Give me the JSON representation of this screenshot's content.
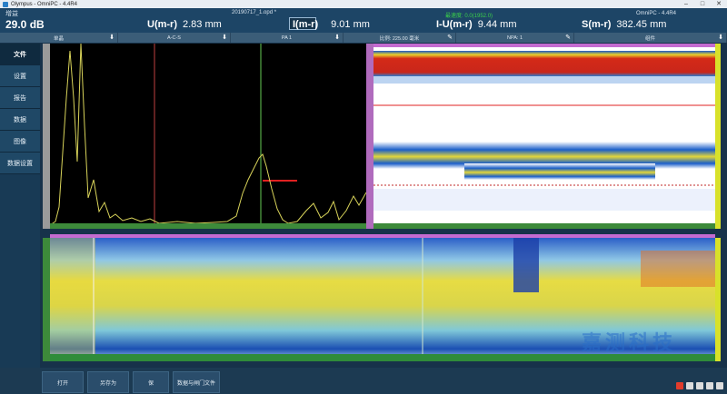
{
  "window": {
    "title": "Olympus - OmniPC - 4.4R4"
  },
  "readout": {
    "gain_label": "增益",
    "gain_value": "29.0 dB",
    "file_name": "20190717_1.opd *",
    "status_text": "最速度: 0.0(1952.0)",
    "right_title": "OmniPC - 4.4R4",
    "u_label": "U(m-r)",
    "u_value": "2.83 mm",
    "i_label": "I(m-r)",
    "i_value": "9.01 mm",
    "iu_label": "I-U(m-r)",
    "iu_value": "9.44 mm",
    "s_label": "S(m-r)",
    "s_value": "382.45 mm"
  },
  "params": [
    {
      "label": "单晶"
    },
    {
      "label": "A-C-S"
    },
    {
      "label": "PA 1"
    },
    {
      "label": "比例: 225.00 毫米"
    },
    {
      "label": "NPA: 1"
    },
    {
      "label": "组件"
    }
  ],
  "nav": [
    {
      "label": "文件",
      "active": true
    },
    {
      "label": "设置"
    },
    {
      "label": "报告"
    },
    {
      "label": "数据"
    },
    {
      "label": "图像"
    },
    {
      "label": "数据设置"
    }
  ],
  "bottom_buttons": [
    {
      "label": "打开"
    },
    {
      "label": "另存为"
    },
    {
      "label": "保"
    },
    {
      "label": "数据与闸门文件"
    }
  ],
  "watermark": "嘉测科技",
  "colors": {
    "accent": "#1d4566",
    "status_green": "#3bd04a",
    "cursor_red": "#e02020"
  }
}
